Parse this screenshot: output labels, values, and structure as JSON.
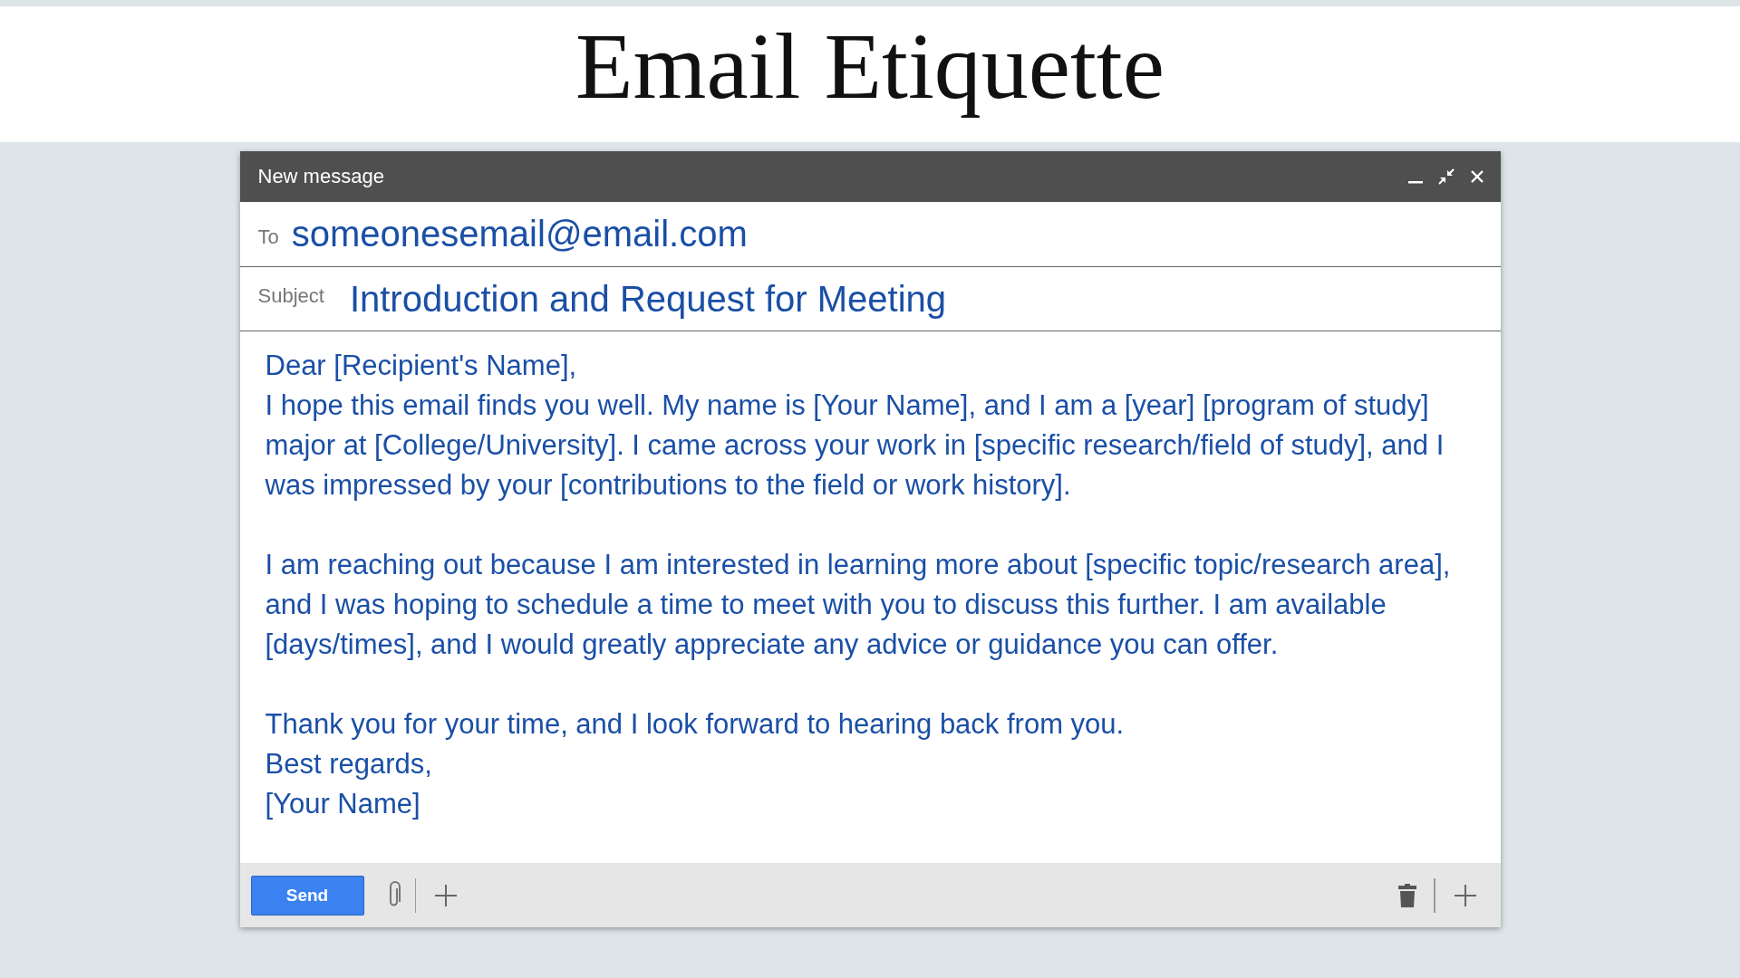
{
  "page_title": "Email Etiquette",
  "window": {
    "title": "New message"
  },
  "to": {
    "label": "To",
    "value": "someonesemail@email.com"
  },
  "subject": {
    "label": "Subject",
    "value": "Introduction and Request for Meeting"
  },
  "body": [
    {
      "kind": "line",
      "text": "Dear [Recipient's Name],"
    },
    {
      "kind": "line",
      "text": "I hope this email finds you well. My name is [Your Name], and I am a [year] [program of study] major at [College/University]. I came across your work in [specific research/field of study], and I was impressed by your [contributions to the field or work history]."
    },
    {
      "kind": "gap"
    },
    {
      "kind": "line",
      "text": "I am reaching out because I am interested in learning more about [specific topic/research area], and I was hoping to schedule a time to meet with you to discuss this further. I am available [days/times], and I would greatly appreciate any advice or guidance you can offer."
    },
    {
      "kind": "gap"
    },
    {
      "kind": "line",
      "text": "Thank you for your time, and I look forward to hearing back from you."
    },
    {
      "kind": "line",
      "text": "Best regards,"
    },
    {
      "kind": "line",
      "text": "[Your Name]"
    }
  ],
  "send_button": "Send"
}
